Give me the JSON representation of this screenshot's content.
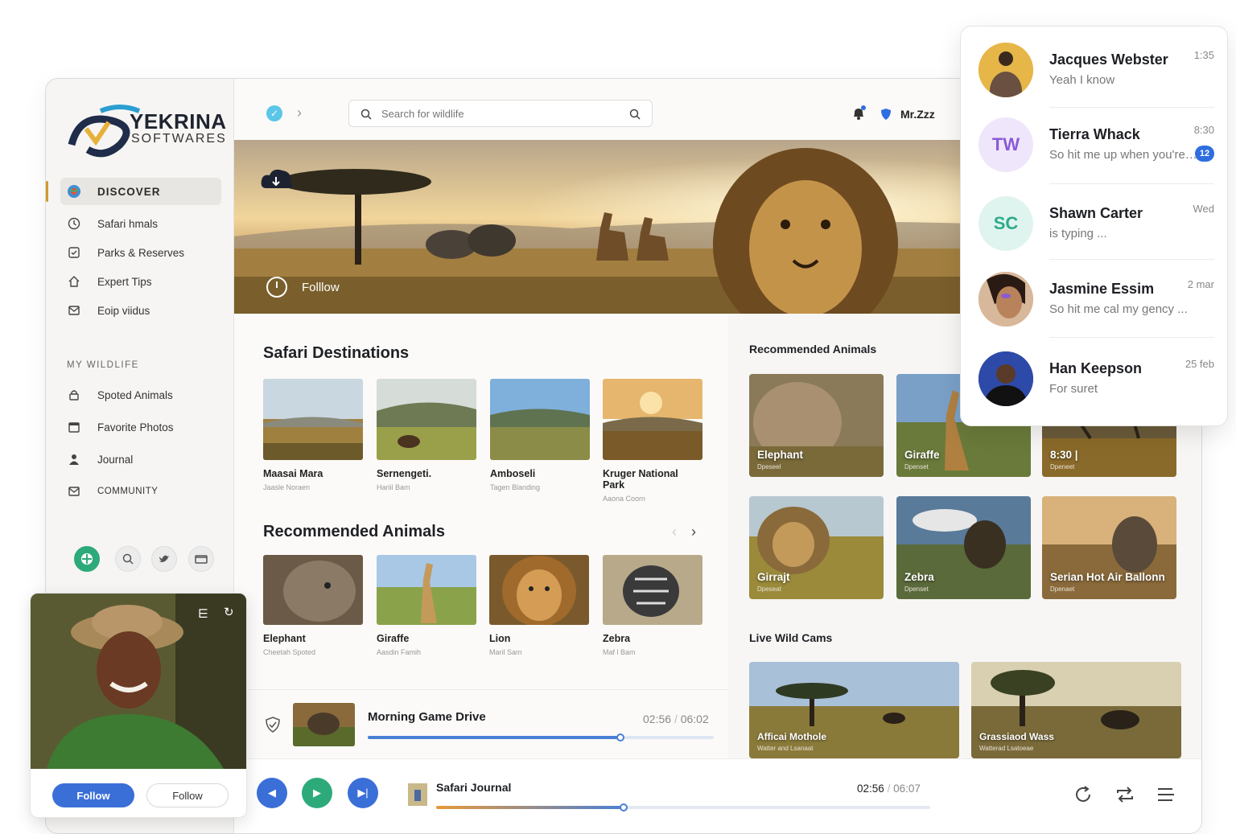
{
  "brand": {
    "name": "YEKRINA",
    "sub": "SOFTWARES"
  },
  "sidebar": {
    "items": [
      {
        "label": "DISCOVER",
        "icon": "globe-icon"
      },
      {
        "label": "Safari hmals",
        "icon": "clock-icon"
      },
      {
        "label": "Parks & Reserves",
        "icon": "checkbox-icon"
      },
      {
        "label": "Expert Tips",
        "icon": "home-icon"
      },
      {
        "label": "Eoip viidus",
        "icon": "mail-icon"
      }
    ],
    "section_label": "MY WILDLIFE",
    "wildlife_items": [
      {
        "label": "Spoted Animals",
        "icon": "lock-icon"
      },
      {
        "label": "Favorite Photos",
        "icon": "calendar-icon"
      },
      {
        "label": "Journal",
        "icon": "user-icon"
      },
      {
        "label": "COMMUNITY",
        "icon": "mail-icon"
      }
    ]
  },
  "topbar": {
    "search_placeholder": "Search for wildlife",
    "user_name": "Mr.Zzz"
  },
  "hero": {
    "follow_label": "Folllow"
  },
  "destinations": {
    "title": "Safari Destinations",
    "items": [
      {
        "title": "Maasai Mara",
        "sub": "Jaasle Noraen"
      },
      {
        "title": "Sernengeti.",
        "sub": "Hariil Bam"
      },
      {
        "title": "Amboseli",
        "sub": "Tagen Blanding"
      },
      {
        "title": "Kruger National Park",
        "sub": "Aaona Coorn"
      }
    ]
  },
  "recommended": {
    "title": "Recommended Animals",
    "items": [
      {
        "title": "Elephant",
        "sub": "Cheetah Spoted"
      },
      {
        "title": "Giraffe",
        "sub": "Aasdin Famih"
      },
      {
        "title": "Lion",
        "sub": "Maril Sam"
      },
      {
        "title": "Zebra",
        "sub": "Maf l Bam"
      }
    ]
  },
  "right": {
    "title": "Recommended Animals",
    "tiles": [
      {
        "label": "Elephant",
        "sub": "Dpeseel"
      },
      {
        "label": "Giraffe",
        "sub": "Dpenset"
      },
      {
        "label": "8:30 |",
        "sub": "Dpeneet"
      },
      {
        "label": "Girrajt",
        "sub": "Dpeseat"
      },
      {
        "label": "Zebra",
        "sub": "Dpenset"
      },
      {
        "label": "Serian Hot Air Ballonn",
        "sub": "Dpenaet"
      }
    ],
    "cams_title": "Live Wild Cams",
    "cams": [
      {
        "label": "Afficai Mothole",
        "sub": "Watter and Lsanaat"
      },
      {
        "label": "Grassiaod Wass",
        "sub": "Watterad Lsatoeae"
      }
    ]
  },
  "mini_player": {
    "title": "Morning Game Drive",
    "elapsed": "02:56",
    "separator": "/",
    "total": "06:02",
    "progress": 0.73
  },
  "player": {
    "title": "Safari Journal",
    "elapsed": "02:56",
    "separator": "/",
    "total": "06:07",
    "progress": 0.38
  },
  "video": {
    "follow_primary": "Follow",
    "follow_secondary": "Follow"
  },
  "chat": [
    {
      "name": "Jacques Webster",
      "message": "Yeah I know",
      "time": "1:35",
      "avatar": "photo",
      "badge": ""
    },
    {
      "name": "Tierra Whack",
      "message": "So hit me up when you're free",
      "time": "8:30",
      "avatar": "TW",
      "badge": "12"
    },
    {
      "name": "Shawn Carter",
      "message": "is typing ...",
      "time": "Wed",
      "avatar": "SC",
      "badge": ""
    },
    {
      "name": "Jasmine Essim",
      "message": "So hit me cal my gency ...",
      "time": "2 mar",
      "avatar": "photo",
      "badge": ""
    },
    {
      "name": "Han Keepson",
      "message": "For suret",
      "time": "25 feb",
      "avatar": "photo",
      "badge": ""
    }
  ],
  "colors": {
    "accent": "#2f6ee0",
    "gold": "#d09a2c",
    "green": "#2daa7a"
  }
}
